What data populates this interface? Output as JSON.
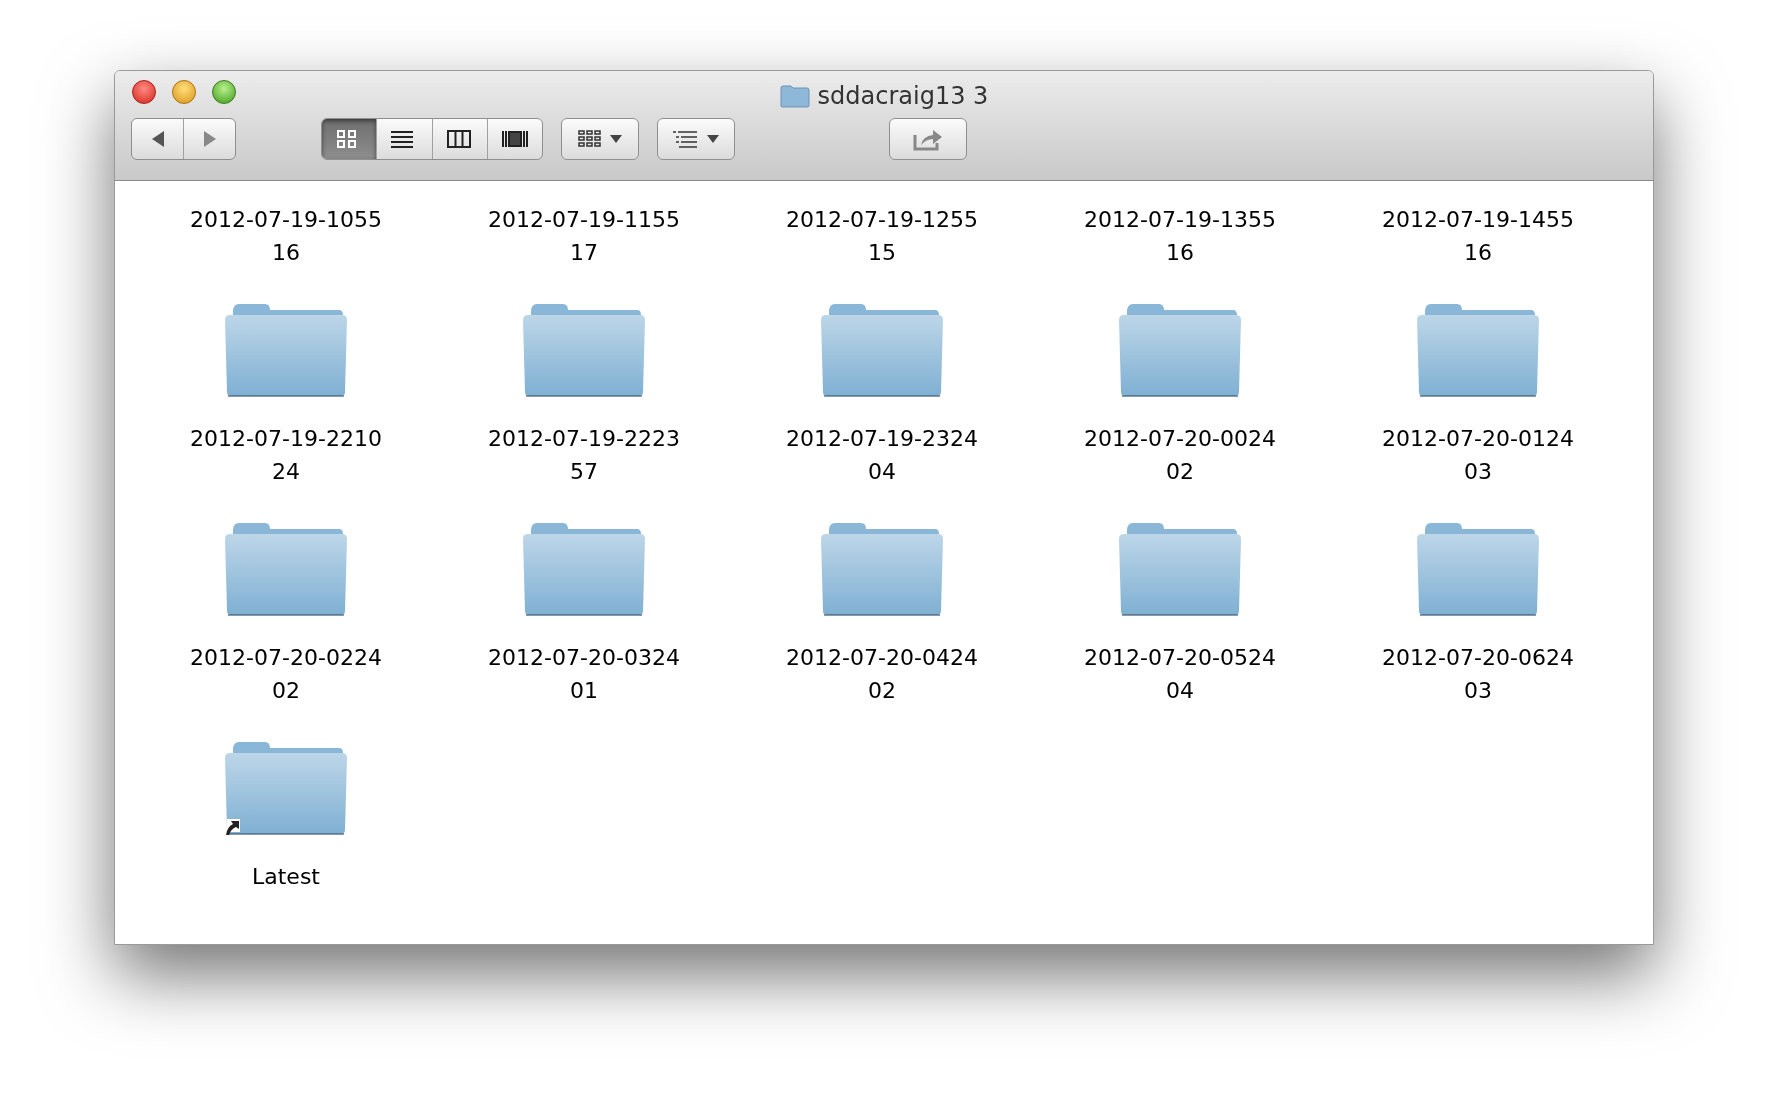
{
  "window": {
    "title": "sddacraig13 3"
  },
  "toolbar": {
    "view_modes": [
      {
        "kind": "icons",
        "selected": true
      },
      {
        "kind": "list",
        "selected": false
      },
      {
        "kind": "columns",
        "selected": false
      },
      {
        "kind": "coverflow",
        "selected": false
      }
    ]
  },
  "items": [
    {
      "label_lines": [
        "2012-07-19-1055",
        "16"
      ],
      "icon_shown": false
    },
    {
      "label_lines": [
        "2012-07-19-1155",
        "17"
      ],
      "icon_shown": false
    },
    {
      "label_lines": [
        "2012-07-19-1255",
        "15"
      ],
      "icon_shown": false
    },
    {
      "label_lines": [
        "2012-07-19-1355",
        "16"
      ],
      "icon_shown": false
    },
    {
      "label_lines": [
        "2012-07-19-1455",
        "16"
      ],
      "icon_shown": false
    },
    {
      "label_lines": [
        "2012-07-19-2210",
        "24"
      ],
      "icon_shown": true,
      "alias": false
    },
    {
      "label_lines": [
        "2012-07-19-2223",
        "57"
      ],
      "icon_shown": true,
      "alias": false
    },
    {
      "label_lines": [
        "2012-07-19-2324",
        "04"
      ],
      "icon_shown": true,
      "alias": false
    },
    {
      "label_lines": [
        "2012-07-20-0024",
        "02"
      ],
      "icon_shown": true,
      "alias": false
    },
    {
      "label_lines": [
        "2012-07-20-0124",
        "03"
      ],
      "icon_shown": true,
      "alias": false
    },
    {
      "label_lines": [
        "2012-07-20-0224",
        "02"
      ],
      "icon_shown": true,
      "alias": false
    },
    {
      "label_lines": [
        "2012-07-20-0324",
        "01"
      ],
      "icon_shown": true,
      "alias": false
    },
    {
      "label_lines": [
        "2012-07-20-0424",
        "02"
      ],
      "icon_shown": true,
      "alias": false
    },
    {
      "label_lines": [
        "2012-07-20-0524",
        "04"
      ],
      "icon_shown": true,
      "alias": false
    },
    {
      "label_lines": [
        "2012-07-20-0624",
        "03"
      ],
      "icon_shown": true,
      "alias": false
    },
    {
      "label_lines": [
        "Latest"
      ],
      "icon_shown": true,
      "alias": true
    }
  ]
}
